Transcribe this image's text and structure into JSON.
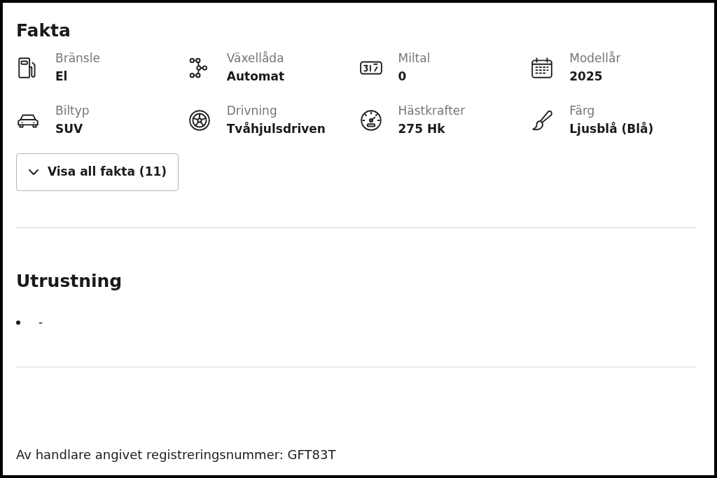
{
  "facts": {
    "title": "Fakta",
    "items": [
      {
        "label": "Bränsle",
        "value": "El"
      },
      {
        "label": "Växellåda",
        "value": "Automat"
      },
      {
        "label": "Miltal",
        "value": "0"
      },
      {
        "label": "Modellår",
        "value": "2025"
      },
      {
        "label": "Biltyp",
        "value": "SUV"
      },
      {
        "label": "Drivning",
        "value": "Tvåhjulsdriven"
      },
      {
        "label": "Hästkrafter",
        "value": "275 Hk"
      },
      {
        "label": "Färg",
        "value": "Ljusblå (Blå)"
      }
    ],
    "show_all_button": "Visa all fakta (11)"
  },
  "equipment": {
    "title": "Utrustning",
    "items": [
      "-"
    ]
  },
  "registration": "Av handlare angivet registreringsnummer: GFT83T"
}
